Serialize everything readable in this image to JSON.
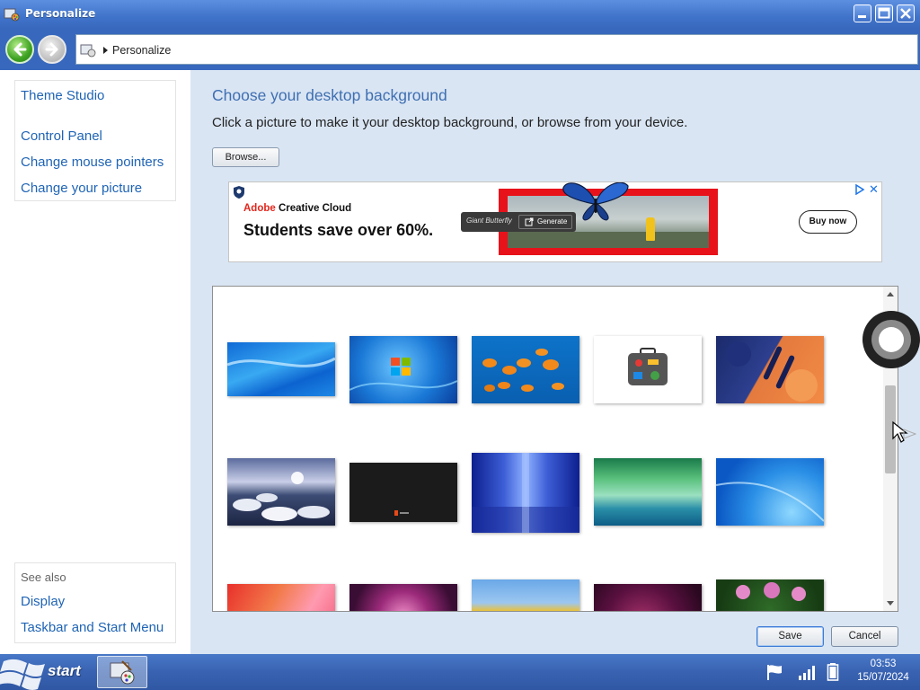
{
  "window": {
    "title": "Personalize",
    "address": "Personalize"
  },
  "sidebar": {
    "items": [
      {
        "label": "Theme Studio"
      },
      {
        "label": "Control Panel"
      },
      {
        "label": "Change mouse pointers"
      },
      {
        "label": "Change your picture"
      }
    ],
    "see_also": {
      "title": "See also",
      "items": [
        {
          "label": "Display"
        },
        {
          "label": "Taskbar and Start Menu"
        }
      ]
    }
  },
  "main": {
    "heading": "Choose your desktop background",
    "subheading": "Click a picture to make it your desktop background, or browse from your device.",
    "browse_label": "Browse...",
    "save_label": "Save",
    "cancel_label": "Cancel"
  },
  "ad": {
    "brand_prefix": "Adobe",
    "brand_name": "Creative Cloud",
    "headline": "Students save over 60%.",
    "chip_label": "Giant Butterfly",
    "chip_button": "Generate",
    "cta": "Buy now",
    "close_glyph": "✕"
  },
  "gallery": {
    "wallpapers": [
      {
        "name": "blue-wave"
      },
      {
        "name": "windows-7-logo"
      },
      {
        "name": "orange-fish"
      },
      {
        "name": "travel-suitcase"
      },
      {
        "name": "abstract-orange-blue"
      },
      {
        "name": "icebergs-sunset"
      },
      {
        "name": "dark-logo"
      },
      {
        "name": "blue-light-rays"
      },
      {
        "name": "green-aurora"
      },
      {
        "name": "blue-swirl"
      },
      {
        "name": "red-waves"
      },
      {
        "name": "purple-flower"
      },
      {
        "name": "yellow-tulips"
      },
      {
        "name": "dark-red-rose"
      },
      {
        "name": "pink-lotus"
      }
    ]
  },
  "taskbar": {
    "start_label": "start",
    "time": "03:53",
    "date": "15/07/2024"
  }
}
